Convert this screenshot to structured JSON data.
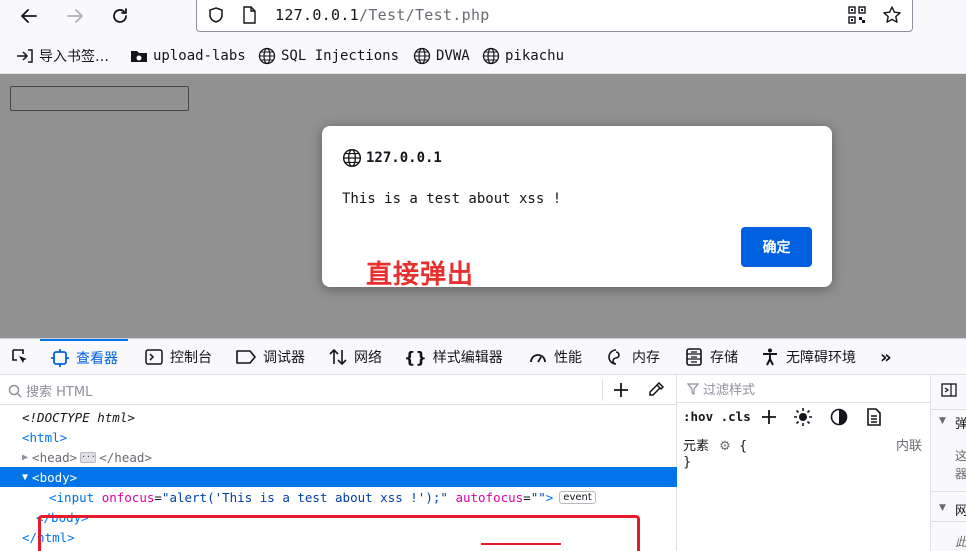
{
  "browser": {
    "url_host": "127.0.0.1",
    "url_path": "/Test/Test.php"
  },
  "bookmarks": [
    {
      "label": "导入书签…",
      "icon": "import-icon"
    },
    {
      "label": "upload-labs",
      "icon": "folder-icon"
    },
    {
      "label": "SQL Injections",
      "icon": "globe-icon"
    },
    {
      "label": "DVWA",
      "icon": "globe-icon"
    },
    {
      "label": "pikachu",
      "icon": "globe-icon"
    }
  ],
  "dialog": {
    "origin": "127.0.0.1",
    "message": "This is a test about xss !",
    "ok_label": "确定"
  },
  "annotation": "直接弹出",
  "devtools": {
    "tabs": [
      {
        "label": "查看器",
        "icon": "inspector-icon",
        "active": true
      },
      {
        "label": "控制台",
        "icon": "console-icon"
      },
      {
        "label": "调试器",
        "icon": "debugger-icon"
      },
      {
        "label": "网络",
        "icon": "network-icon"
      },
      {
        "label": "样式编辑器",
        "icon": "braces-icon"
      },
      {
        "label": "性能",
        "icon": "performance-icon"
      },
      {
        "label": "内存",
        "icon": "memory-icon"
      },
      {
        "label": "存储",
        "icon": "storage-icon"
      },
      {
        "label": "无障碍环境",
        "icon": "accessibility-icon"
      }
    ],
    "search_placeholder": "搜索 HTML",
    "tree": {
      "doctype": "<!DOCTYPE html>",
      "html_open": "html",
      "head": "head",
      "body": "body",
      "input_tag": "input",
      "attr1_name": "onfocus",
      "attr1_value": "\"alert('This is a test about xss !');\"",
      "attr2_name": "autofocus",
      "attr2_value": "\"\"",
      "event_badge": "event",
      "body_close": "</body>",
      "html_close": "</html>"
    },
    "rules": {
      "filter_placeholder": "过滤样式",
      "hov_cls": ":hov .cls",
      "element_label": "元素",
      "inline_label": "内联",
      "brace_open": "{",
      "brace_close": "}"
    },
    "sidebar_glyphs": [
      "弹",
      "这",
      "器",
      "网",
      "此"
    ]
  }
}
